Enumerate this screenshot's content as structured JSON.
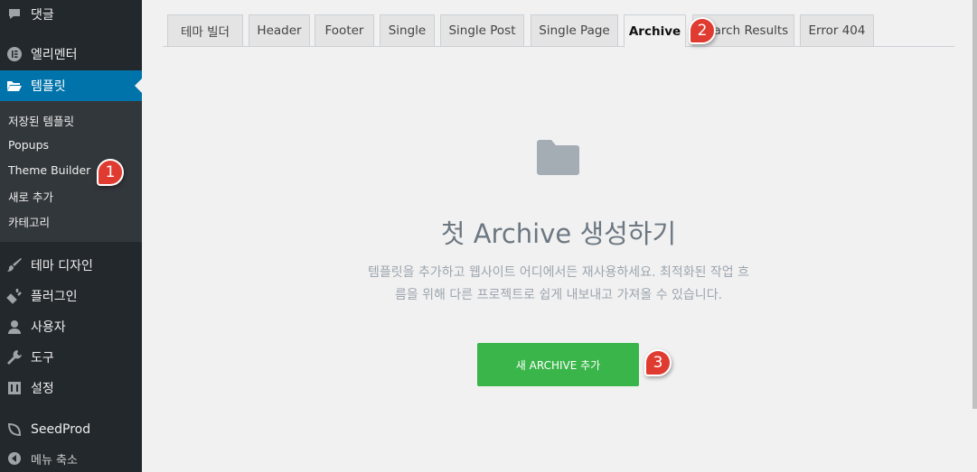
{
  "sidebar": {
    "items": [
      {
        "label": "댓글",
        "icon": "comment-icon"
      },
      {
        "label": "엘리멘터",
        "icon": "elementor-icon"
      },
      {
        "label": "템플릿",
        "icon": "folder-open-icon"
      },
      {
        "label": "테마 디자인",
        "icon": "brush-icon"
      },
      {
        "label": "플러그인",
        "icon": "plugin-icon"
      },
      {
        "label": "사용자",
        "icon": "user-icon"
      },
      {
        "label": "도구",
        "icon": "wrench-icon"
      },
      {
        "label": "설정",
        "icon": "settings-icon"
      },
      {
        "label": "SeedProd",
        "icon": "seedprod-icon"
      },
      {
        "label": "메뉴 축소",
        "icon": "collapse-icon"
      }
    ],
    "submenu": [
      "저장된 템플릿",
      "Popups",
      "Theme Builder",
      "새로 추가",
      "카테고리"
    ]
  },
  "tabs": [
    "테마 빌더",
    "Header",
    "Footer",
    "Single",
    "Single Post",
    "Single Page",
    "Archive",
    "Search Results",
    "Error 404"
  ],
  "main": {
    "headline": "첫 Archive 생성하기",
    "description_line1": "템플릿을 추가하고 웹사이트 어디에서든 재사용하세요. 최적화된 작업 흐",
    "description_line2": "름을 위해 다른 프로젝트로 쉽게 내보내고 가져올 수 있습니다.",
    "button_label": "새 ARCHIVE 추가"
  },
  "markers": [
    "1",
    "2",
    "3"
  ],
  "colors": {
    "sidebar": "#23282d",
    "active": "#0073aa",
    "button": "#39b54a",
    "marker": "#e03b31"
  }
}
